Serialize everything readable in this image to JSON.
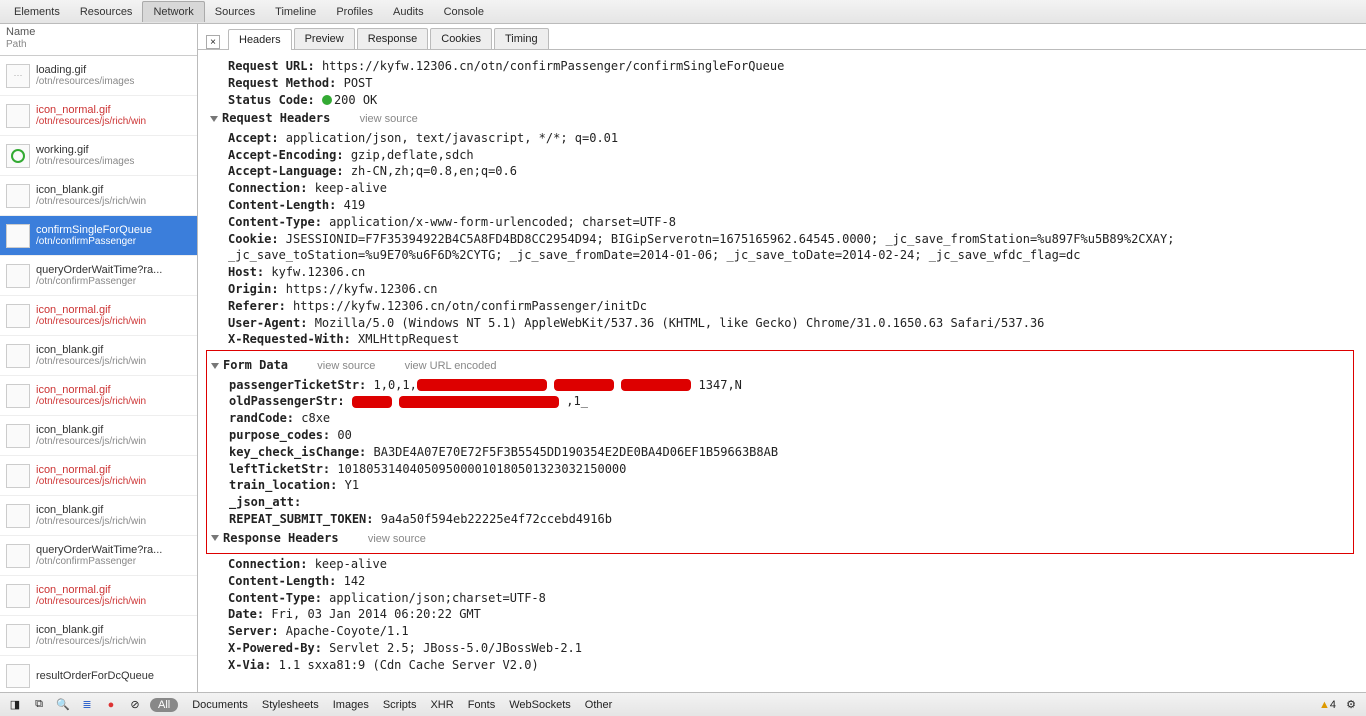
{
  "topTabs": [
    "Elements",
    "Resources",
    "Network",
    "Sources",
    "Timeline",
    "Profiles",
    "Audits",
    "Console"
  ],
  "activeTop": 2,
  "sideHeader": {
    "h1": "Name",
    "h2": "Path"
  },
  "rows": [
    {
      "name": "loading.gif",
      "path": "/otn/resources/images",
      "red": false,
      "icon": "dots"
    },
    {
      "name": "icon_normal.gif",
      "path": "/otn/resources/js/rich/win",
      "red": true
    },
    {
      "name": "working.gif",
      "path": "/otn/resources/images",
      "red": false,
      "icon": "circle"
    },
    {
      "name": "icon_blank.gif",
      "path": "/otn/resources/js/rich/win",
      "red": false
    },
    {
      "name": "confirmSingleForQueue",
      "path": "/otn/confirmPassenger",
      "red": false,
      "sel": true
    },
    {
      "name": "queryOrderWaitTime?ra...",
      "path": "/otn/confirmPassenger",
      "red": false
    },
    {
      "name": "icon_normal.gif",
      "path": "/otn/resources/js/rich/win",
      "red": true
    },
    {
      "name": "icon_blank.gif",
      "path": "/otn/resources/js/rich/win",
      "red": false
    },
    {
      "name": "icon_normal.gif",
      "path": "/otn/resources/js/rich/win",
      "red": true
    },
    {
      "name": "icon_blank.gif",
      "path": "/otn/resources/js/rich/win",
      "red": false
    },
    {
      "name": "icon_normal.gif",
      "path": "/otn/resources/js/rich/win",
      "red": true
    },
    {
      "name": "icon_blank.gif",
      "path": "/otn/resources/js/rich/win",
      "red": false
    },
    {
      "name": "queryOrderWaitTime?ra...",
      "path": "/otn/confirmPassenger",
      "red": false
    },
    {
      "name": "icon_normal.gif",
      "path": "/otn/resources/js/rich/win",
      "red": true
    },
    {
      "name": "icon_blank.gif",
      "path": "/otn/resources/js/rich/win",
      "red": false
    },
    {
      "name": "resultOrderForDcQueue",
      "path": "",
      "red": false
    }
  ],
  "detailTabs": [
    "Headers",
    "Preview",
    "Response",
    "Cookies",
    "Timing"
  ],
  "activeDetail": 0,
  "general": {
    "url_k": "Request URL:",
    "url": "https://kyfw.12306.cn/otn/confirmPassenger/confirmSingleForQueue",
    "method_k": "Request Method:",
    "method": "POST",
    "status_k": "Status Code:",
    "status": "200 OK"
  },
  "reqHeadTitle": "Request Headers",
  "viewSource": "view source",
  "viewUrlEnc": "view URL encoded",
  "reqHeaders": [
    {
      "k": "Accept:",
      "v": "application/json, text/javascript, */*; q=0.01"
    },
    {
      "k": "Accept-Encoding:",
      "v": "gzip,deflate,sdch"
    },
    {
      "k": "Accept-Language:",
      "v": "zh-CN,zh;q=0.8,en;q=0.6"
    },
    {
      "k": "Connection:",
      "v": "keep-alive"
    },
    {
      "k": "Content-Length:",
      "v": "419"
    },
    {
      "k": "Content-Type:",
      "v": "application/x-www-form-urlencoded; charset=UTF-8"
    },
    {
      "k": "Cookie:",
      "v": "JSESSIONID=F7F35394922B4C5A8FD4BD8CC2954D94; BIGipServerotn=1675165962.64545.0000; _jc_save_fromStation=%u897F%u5B89%2CXAY; _jc_save_toStation=%u9E70%u6F6D%2CYTG; _jc_save_fromDate=2014-01-06; _jc_save_toDate=2014-02-24; _jc_save_wfdc_flag=dc"
    },
    {
      "k": "Host:",
      "v": "kyfw.12306.cn"
    },
    {
      "k": "Origin:",
      "v": "https://kyfw.12306.cn"
    },
    {
      "k": "Referer:",
      "v": "https://kyfw.12306.cn/otn/confirmPassenger/initDc"
    },
    {
      "k": "User-Agent:",
      "v": "Mozilla/5.0 (Windows NT 5.1) AppleWebKit/537.36 (KHTML, like Gecko) Chrome/31.0.1650.63 Safari/537.36"
    },
    {
      "k": "X-Requested-With:",
      "v": "XMLHttpRequest"
    }
  ],
  "formDataTitle": "Form Data",
  "formData": [
    {
      "k": "passengerTicketStr:",
      "v": "1,0,1,",
      "redact": [
        130,
        60,
        70
      ],
      "suffix": "1347,N"
    },
    {
      "k": "oldPassengerStr:",
      "v": "",
      "redact": [
        40,
        160
      ],
      "suffix": ",1_"
    },
    {
      "k": "randCode:",
      "v": "c8xe"
    },
    {
      "k": "purpose_codes:",
      "v": "00"
    },
    {
      "k": "key_check_isChange:",
      "v": "BA3DE4A07E70E72F5F3B5545DD190354E2DE0BA4D06EF1B59663B8AB"
    },
    {
      "k": "leftTicketStr:",
      "v": "1018053140405095000010180501323032150000"
    },
    {
      "k": "train_location:",
      "v": "Y1"
    },
    {
      "k": "_json_att:",
      "v": ""
    },
    {
      "k": "REPEAT_SUBMIT_TOKEN:",
      "v": "9a4a50f594eb22225e4f72ccebd4916b"
    }
  ],
  "respHeadTitle": "Response Headers",
  "respHeaders": [
    {
      "k": "Connection:",
      "v": "keep-alive"
    },
    {
      "k": "Content-Length:",
      "v": "142"
    },
    {
      "k": "Content-Type:",
      "v": "application/json;charset=UTF-8"
    },
    {
      "k": "Date:",
      "v": "Fri, 03 Jan 2014 06:20:22 GMT"
    },
    {
      "k": "Server:",
      "v": "Apache-Coyote/1.1"
    },
    {
      "k": "X-Powered-By:",
      "v": "Servlet 2.5; JBoss-5.0/JBossWeb-2.1"
    },
    {
      "k": "X-Via:",
      "v": "1.1 sxxa81:9 (Cdn Cache Server V2.0)"
    }
  ],
  "bottomFilters": [
    "All",
    "Documents",
    "Stylesheets",
    "Images",
    "Scripts",
    "XHR",
    "Fonts",
    "WebSockets",
    "Other"
  ],
  "warnCount": "4"
}
